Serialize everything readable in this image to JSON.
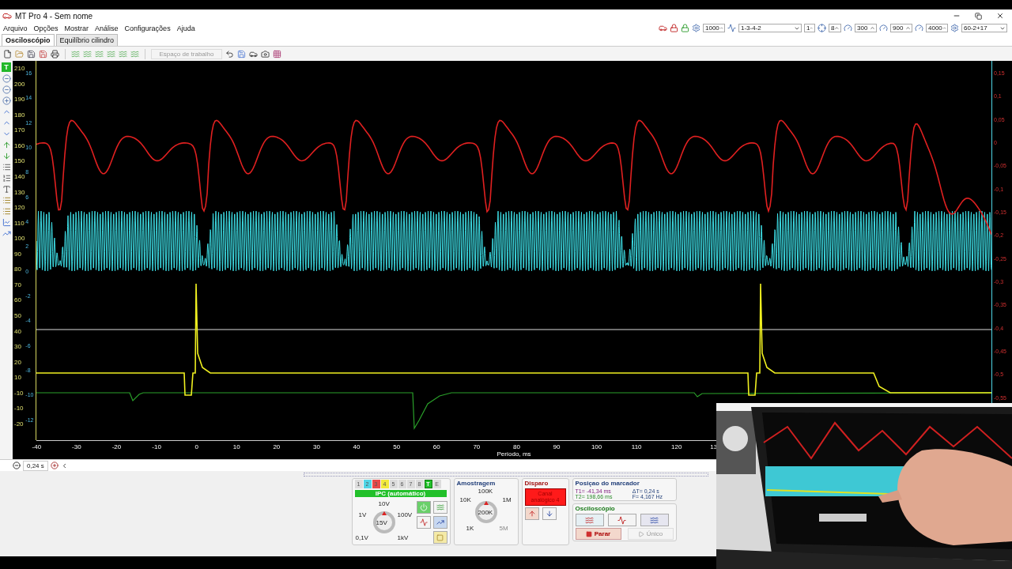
{
  "window": {
    "title": "MT Pro 4 - Sem nome"
  },
  "menu": [
    "Arquivo",
    "Opções",
    "Mostrar",
    "Análise",
    "Configurações",
    "Ajuda"
  ],
  "settings_bar": [
    {
      "kind": "spin",
      "value": "1000"
    },
    {
      "kind": "dropdown",
      "value": "1-3-4-2"
    },
    {
      "kind": "spin",
      "value": "1"
    },
    {
      "kind": "spin",
      "value": "8"
    },
    {
      "kind": "spin",
      "value": "300"
    },
    {
      "kind": "spin",
      "value": "900"
    },
    {
      "kind": "spin",
      "value": "4000"
    },
    {
      "kind": "dropdown",
      "value": "60-2+17"
    }
  ],
  "tabs": [
    {
      "label": "Osciloscópio",
      "selected": true
    },
    {
      "label": "Equilíbrio cilindro",
      "selected": false
    }
  ],
  "toolbar": {
    "workspace_button": "Espaço de trabalho"
  },
  "left_toolbar": {
    "trigger_button": "T"
  },
  "plot": {
    "left_ticks": [
      "210",
      "200",
      "190",
      "180",
      "170",
      "160",
      "150",
      "140",
      "130",
      "120",
      "110",
      "100",
      "90",
      "80",
      "70",
      "60",
      "50",
      "40",
      "30",
      "20",
      "10",
      "-10",
      "-10",
      "-20"
    ],
    "left_ticks_2": [
      "16",
      "14",
      "12",
      "10",
      "8",
      "6",
      "4",
      "2",
      "0",
      "-2",
      "-4",
      "-6",
      "-8",
      "-10",
      "-12"
    ],
    "right_ticks": [
      "0,15",
      "0,1",
      "0,05",
      "0",
      "-0,05",
      "-0,1",
      "-0,15",
      "-0,2",
      "-0,25",
      "-0,3",
      "-0,35",
      "-0,4",
      "-0,45",
      "-0,5",
      "-0,55"
    ],
    "x_ticks": [
      "-40",
      "-30",
      "-20",
      "-10",
      "0",
      "10",
      "20",
      "30",
      "40",
      "50",
      "60",
      "70",
      "80",
      "90",
      "100",
      "110",
      "120",
      "13"
    ],
    "x_label": "Período, ms"
  },
  "time_window": "0,24 s",
  "channels": {
    "tabs": [
      {
        "label": "1",
        "color": "#dcdcdc",
        "selected": false
      },
      {
        "label": "2",
        "color": "#4fd6e6",
        "selected": false
      },
      {
        "label": "3",
        "color": "#e84a4a",
        "selected": false
      },
      {
        "label": "4",
        "color": "#f2ea3a",
        "selected": false
      },
      {
        "label": "5",
        "color": "#dcdcdc",
        "selected": false
      },
      {
        "label": "6",
        "color": "#dcdcdc",
        "selected": false
      },
      {
        "label": "7",
        "color": "#dcdcdc",
        "selected": false
      },
      {
        "label": "8",
        "color": "#dcdcdc",
        "selected": false
      },
      {
        "label": "T",
        "color": "#22c02a",
        "selected": true
      },
      {
        "label": "E",
        "color": "#dcdcdc",
        "selected": false
      }
    ],
    "title": "IPC (automático)",
    "knob_labels": [
      {
        "label": "10V",
        "disabled": false
      },
      {
        "label": "1V",
        "disabled": false
      },
      {
        "label": "100V",
        "disabled": false
      },
      {
        "label": "15V",
        "disabled": false
      },
      {
        "label": "0,1V",
        "disabled": false
      },
      {
        "label": "1kV",
        "disabled": false
      }
    ]
  },
  "sampling": {
    "title": "Amostragem",
    "knob_labels": [
      {
        "label": "100K",
        "disabled": false
      },
      {
        "label": "10K",
        "disabled": false
      },
      {
        "label": "1M",
        "disabled": false
      },
      {
        "label": "200K",
        "disabled": false
      },
      {
        "label": "1K",
        "disabled": false
      },
      {
        "label": "5M",
        "disabled": true
      }
    ]
  },
  "trigger": {
    "title": "Disparo",
    "source": "Canal analógico 4"
  },
  "marker": {
    "title": "Posiçao do marcador",
    "t1": "T1= -41,34 ms",
    "dt": "ΔT= 0,24 s",
    "t2": "T2= 198,66 ms",
    "f": "F= 4,167 Hz"
  },
  "scope": {
    "title": "Osciloscópio",
    "buttons": [
      {
        "label": "Parar",
        "disabled": false
      },
      {
        "label": "Único",
        "disabled": true
      }
    ]
  }
}
